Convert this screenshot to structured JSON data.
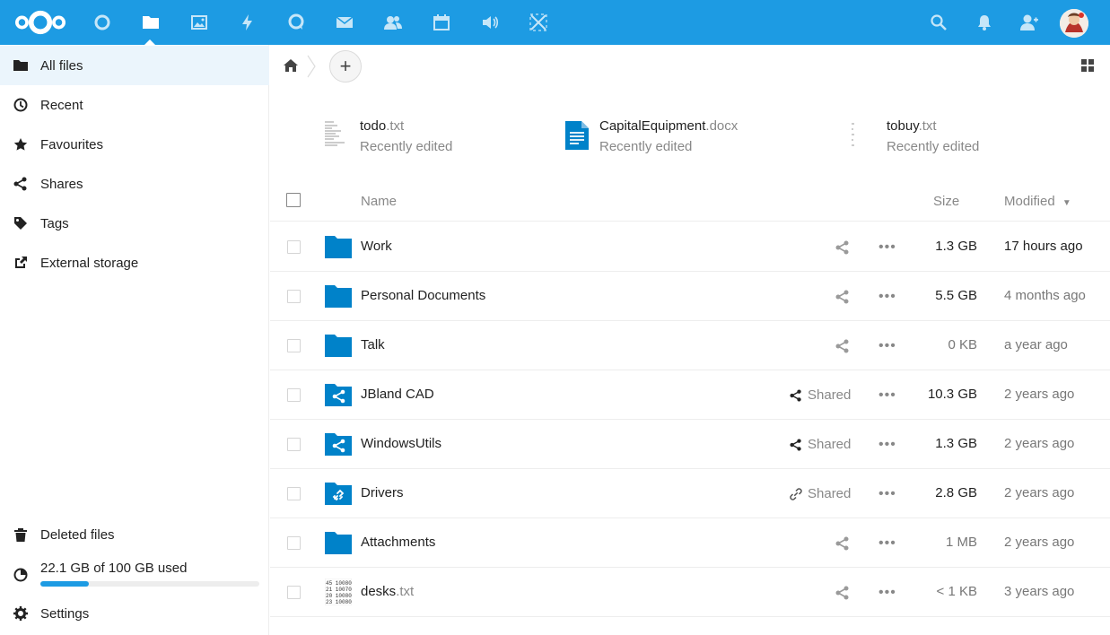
{
  "header": {
    "apps": [
      {
        "icon": "nextcloud-logo-icon"
      },
      {
        "icon": "dashboard-icon"
      },
      {
        "icon": "files-icon",
        "active": true
      },
      {
        "icon": "photos-icon"
      },
      {
        "icon": "activity-icon"
      },
      {
        "icon": "talk-icon"
      },
      {
        "icon": "mail-icon"
      },
      {
        "icon": "contacts-icon"
      },
      {
        "icon": "calendar-icon"
      },
      {
        "icon": "announcements-icon"
      },
      {
        "icon": "integrations-icon"
      }
    ],
    "right": [
      "search-icon",
      "notifications-icon",
      "contacts-menu-icon",
      "user-avatar"
    ]
  },
  "sidebar": {
    "items": [
      {
        "label": "All files",
        "icon": "folder-icon",
        "active": true
      },
      {
        "label": "Recent",
        "icon": "clock-icon"
      },
      {
        "label": "Favourites",
        "icon": "star-icon"
      },
      {
        "label": "Shares",
        "icon": "share-icon"
      },
      {
        "label": "Tags",
        "icon": "tag-icon"
      },
      {
        "label": "External storage",
        "icon": "external-link-icon"
      }
    ],
    "deleted_label": "Deleted files",
    "quota_label": "22.1 GB of 100 GB used",
    "quota_fraction": 0.221,
    "settings_label": "Settings"
  },
  "recent": [
    {
      "name": "todo",
      "ext": ".txt",
      "sub": "Recently edited",
      "icon": "text-file-thumbnail-icon"
    },
    {
      "name": "CapitalEquipment",
      "ext": ".docx",
      "sub": "Recently edited",
      "icon": "document-icon"
    },
    {
      "name": "tobuy",
      "ext": ".txt",
      "sub": "Recently edited",
      "icon": "text-file-thumbnail-icon"
    }
  ],
  "table": {
    "col_name": "Name",
    "col_size": "Size",
    "col_modified": "Modified",
    "rows": [
      {
        "name": "Work",
        "ext": "",
        "size": "1.3 GB",
        "modified": "17 hours ago",
        "icon": "folder-icon",
        "shared": ""
      },
      {
        "name": "Personal Documents",
        "ext": "",
        "size": "5.5 GB",
        "modified": "4 months ago",
        "icon": "folder-icon",
        "shared": ""
      },
      {
        "name": "Talk",
        "ext": "",
        "size": "0 KB",
        "modified": "a year ago",
        "icon": "folder-icon",
        "shared": ""
      },
      {
        "name": "JBland CAD",
        "ext": "",
        "size": "10.3 GB",
        "modified": "2 years ago",
        "icon": "shared-folder-icon",
        "shared": "Shared"
      },
      {
        "name": "WindowsUtils",
        "ext": "",
        "size": "1.3 GB",
        "modified": "2 years ago",
        "icon": "shared-folder-icon",
        "shared": "Shared"
      },
      {
        "name": "Drivers",
        "ext": "",
        "size": "2.8 GB",
        "modified": "2 years ago",
        "icon": "link-folder-icon",
        "shared": "Shared"
      },
      {
        "name": "Attachments",
        "ext": "",
        "size": "1 MB",
        "modified": "2 years ago",
        "icon": "folder-icon",
        "shared": ""
      },
      {
        "name": "desks",
        "ext": ".txt",
        "size": "< 1 KB",
        "modified": "3 years ago",
        "icon": "text-file-thumbnail-icon",
        "shared": ""
      }
    ]
  },
  "colors": {
    "header": "#1d9be3",
    "folder": "#0082c9",
    "active_bg": "#ebf5fc"
  }
}
